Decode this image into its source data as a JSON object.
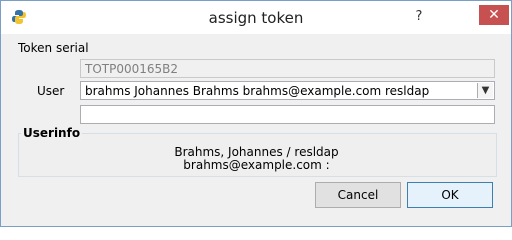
{
  "window": {
    "title": "assign token",
    "help_label": "?",
    "close_label": "✕"
  },
  "form": {
    "section_label": "Token serial",
    "token_serial_value": "TOTP000165B2",
    "user_label": "User",
    "user_value": "brahms Johannes Brahms brahms@example.com resldap",
    "extra_value": ""
  },
  "userinfo": {
    "title": "Userinfo",
    "line1": "Brahms, Johannes / resldap",
    "line2": "brahms@example.com :"
  },
  "buttons": {
    "cancel_label": "Cancel",
    "ok_label": "OK"
  },
  "colors": {
    "close_button": "#c75050",
    "window_border": "#7a9fc7"
  }
}
